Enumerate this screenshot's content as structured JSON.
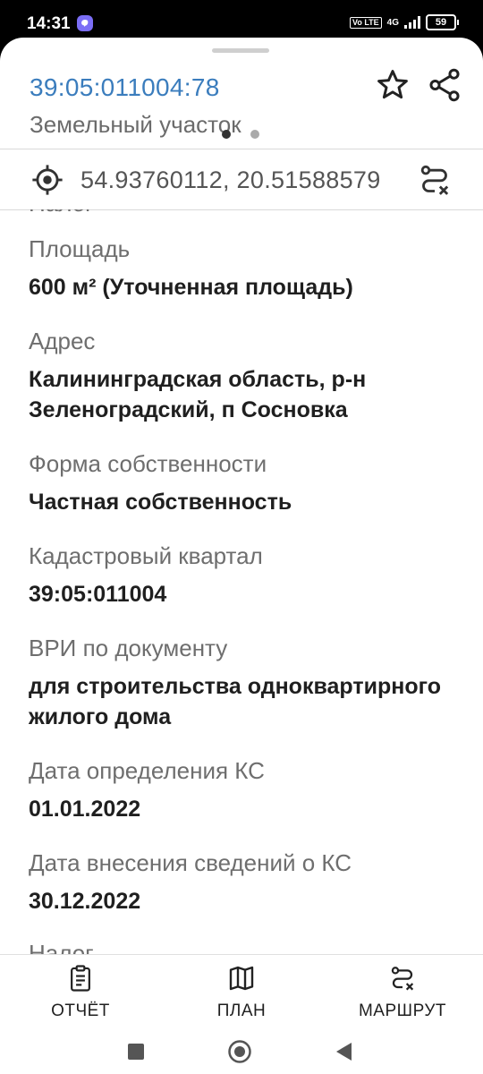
{
  "status_bar": {
    "time": "14:31",
    "volte": "Vo LTE",
    "network": "4G",
    "battery": "59"
  },
  "header": {
    "cadastral_number": "39:05:011004:78",
    "object_type": "Земельный участок"
  },
  "coordinates": {
    "value": "54.93760112, 20.51588579"
  },
  "fields": [
    {
      "label": "Площадь",
      "value": "600 м² (Уточненная площадь)"
    },
    {
      "label": "Адрес",
      "value": "Калининградская область, р-н Зеленоградский, п Сосновка"
    },
    {
      "label": "Форма собственности",
      "value": "Частная собственность"
    },
    {
      "label": "Кадастровый квартал",
      "value": "39:05:011004"
    },
    {
      "label": "ВРИ по документу",
      "value": "для строительства одноквартирного жилого дома"
    },
    {
      "label": "Дата определения КС",
      "value": "01.01.2022"
    },
    {
      "label": "Дата внесения сведений о КС",
      "value": "30.12.2022"
    }
  ],
  "clipped_next_label": "Налог",
  "bottom_nav": [
    {
      "label": "ОТЧЁТ",
      "icon": "clipboard-icon"
    },
    {
      "label": "ПЛАН",
      "icon": "map-icon"
    },
    {
      "label": "МАРШРУТ",
      "icon": "route-icon"
    }
  ],
  "colors": {
    "accent": "#3b7dbd",
    "label": "#6e6e6e",
    "value": "#1f1f1f"
  }
}
